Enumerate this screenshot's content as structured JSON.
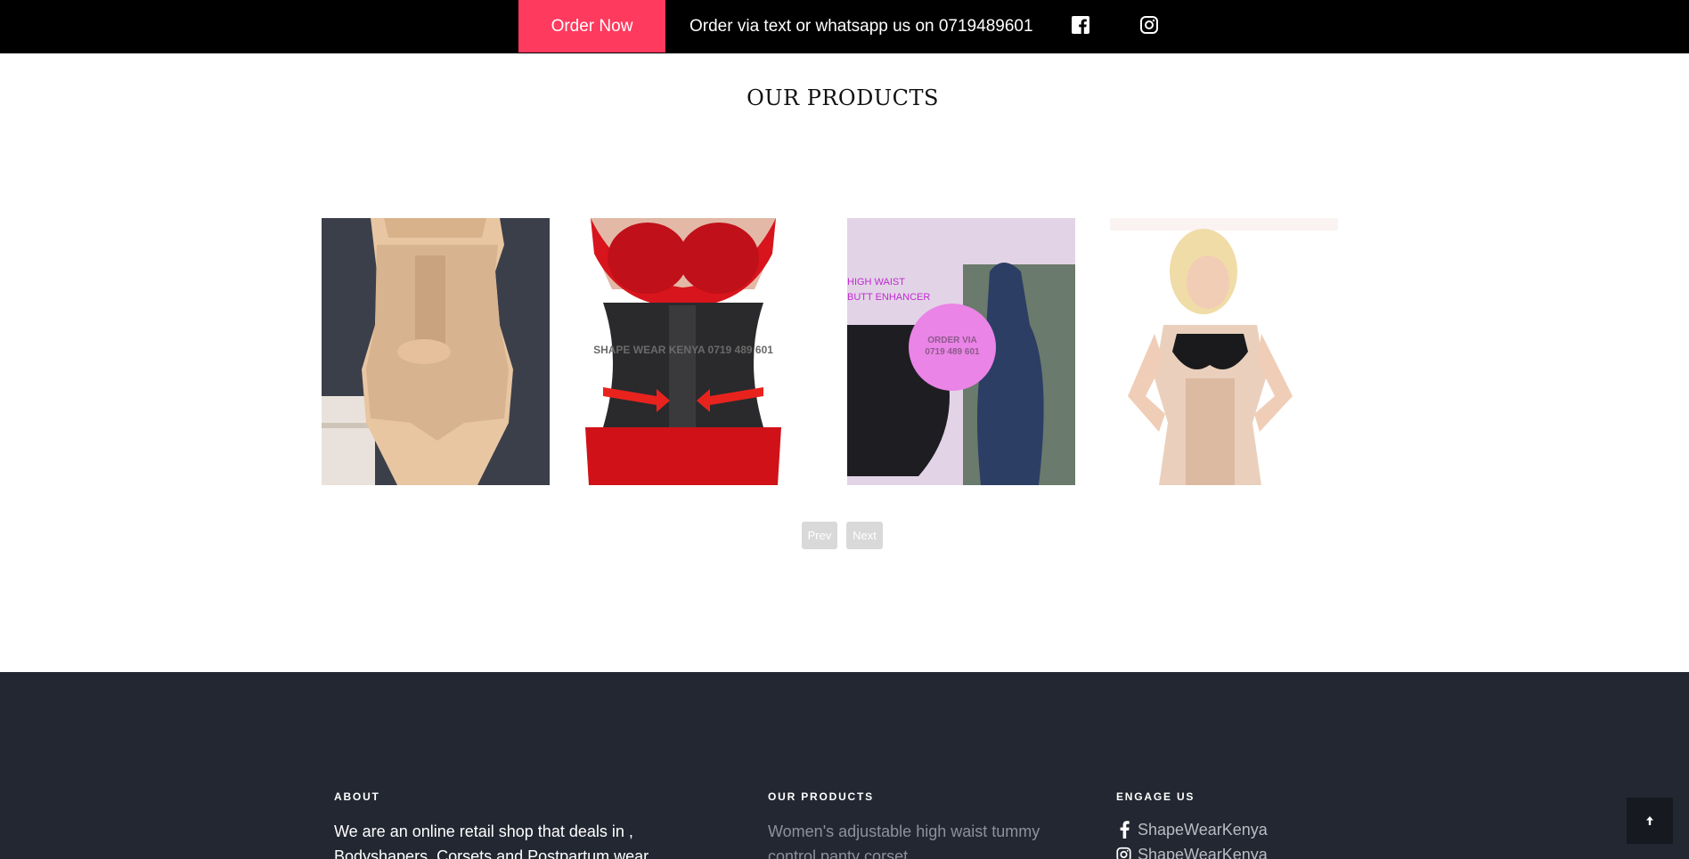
{
  "topbar": {
    "order_button": "Order Now",
    "contact_text": "Order via text or whatsapp us on 0719489601",
    "icons": [
      "facebook-icon",
      "instagram-icon"
    ]
  },
  "products_section": {
    "title": "OUR PRODUCTS",
    "products": [
      {
        "image": "beige high waist tummy control panty"
      },
      {
        "image": "black waist trainer corset",
        "watermark": "SHAPE WEAR KENYA 0719 489 601"
      },
      {
        "image": "high waist butt enhancer panty",
        "overlay_lines": [
          "HIGH WAIST",
          "BUTT ENHANCER"
        ],
        "badge": "ORDER VIA 0719 489 601"
      },
      {
        "image": "nude full body corset shapewear"
      }
    ],
    "pager": {
      "prev": "Prev",
      "next": "Next"
    }
  },
  "footer": {
    "about_heading": "ABOUT",
    "about_text": "We are an online retail shop that deals in , Bodyshapers, Corsets and Postpartum wear",
    "products_heading": "OUR PRODUCTS",
    "products_link": "Women's adjustable high waist tummy control panty corset",
    "engage_heading": "ENGAGE US",
    "facebook_handle": "ShapeWearKenya",
    "instagram_handle": "ShapeWearKenya"
  },
  "colors": {
    "accent": "#fe3a5e",
    "topbar": "#000000",
    "footer": "#222731"
  }
}
